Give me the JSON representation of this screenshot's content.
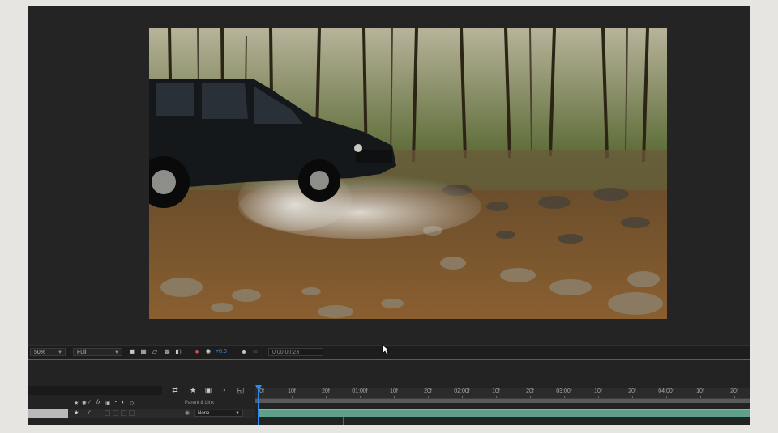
{
  "viewer": {
    "zoom": "50%",
    "resolution": "Full",
    "exposure": "+0.0",
    "timecode": "0;00;00;23"
  },
  "timeline": {
    "ruler_labels": [
      "0f",
      "10f",
      "20f",
      "01:00f",
      "10f",
      "20f",
      "02:00f",
      "10f",
      "20f",
      "03:00f",
      "10f",
      "20f",
      "04:00f",
      "10f",
      "20f"
    ],
    "columns": {
      "parent_link": "Parent & Link"
    },
    "layer": {
      "parent_value": "None"
    }
  },
  "colors": {
    "accent": "#2d8ceb",
    "layer_bar": "#5fa08c",
    "marker": "#c23c3c"
  },
  "icons": [
    "mask-icon",
    "grid-icon",
    "fullscreen-icon",
    "color-icon",
    "camera-icon",
    "draft-3d-icon",
    "motion-blur-icon"
  ]
}
